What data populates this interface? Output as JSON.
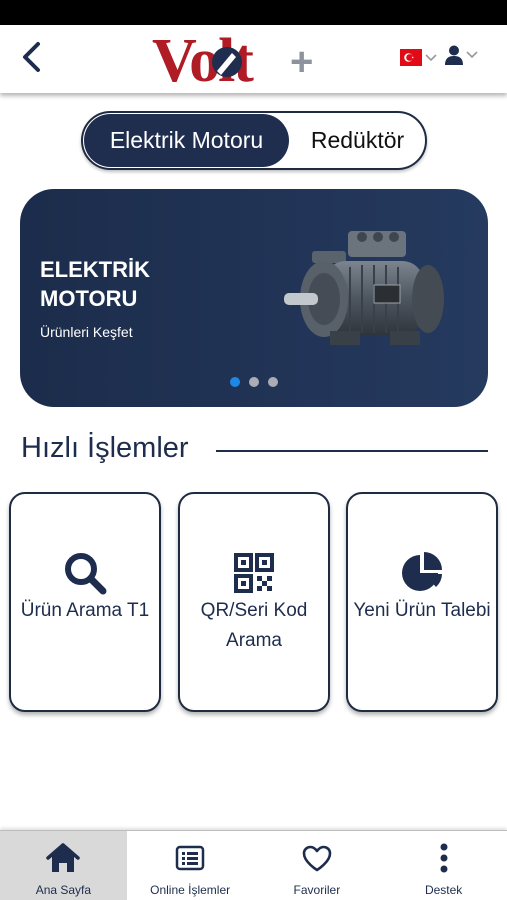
{
  "header": {
    "logo_text": "Volt",
    "logo_plus": "+",
    "language_icon": "turkey-flag-icon",
    "user_icon": "user-icon"
  },
  "segmented_control": {
    "options": [
      {
        "label": "Elektrik Motoru",
        "selected": true
      },
      {
        "label": "Redüktör",
        "selected": false
      }
    ]
  },
  "banner": {
    "title": "ELEKTRİK MOTORU",
    "subtitle": "Ürünleri Keşfet",
    "image": "electric-motor-image",
    "slide_count": 3,
    "active_slide": 1
  },
  "quick_actions": {
    "title": "Hızlı İşlemler",
    "items": [
      {
        "icon": "search-icon",
        "label": "Ürün Arama T1"
      },
      {
        "icon": "qr-code-icon",
        "label": "QR/Seri Kod Arama"
      },
      {
        "icon": "pie-chart-icon",
        "label": "Yeni Ürün Talebi"
      }
    ]
  },
  "bottom_nav": {
    "items": [
      {
        "icon": "home-icon",
        "label": "Ana Sayfa",
        "active": true
      },
      {
        "icon": "list-icon",
        "label": "Online İşlemler",
        "active": false
      },
      {
        "icon": "heart-icon",
        "label": "Favoriler",
        "active": false
      },
      {
        "icon": "more-vertical-icon",
        "label": "Destek",
        "active": false
      }
    ]
  },
  "colors": {
    "brand_navy": "#1f2d4f",
    "brand_red": "#b01c25",
    "accent_blue": "#1e88e5",
    "flag_red": "#e30a17"
  }
}
